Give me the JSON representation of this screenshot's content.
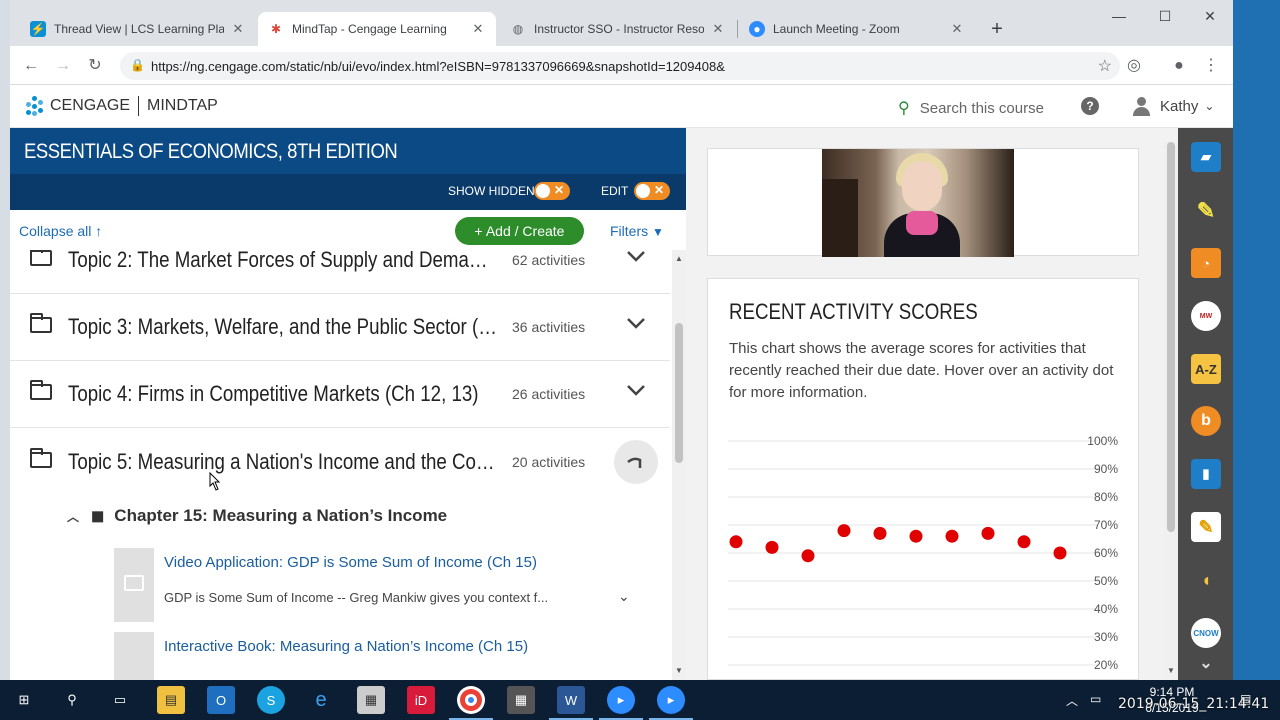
{
  "browser": {
    "tabs": [
      {
        "title": "Thread View | LCS Learning Platf",
        "active": false
      },
      {
        "title": "MindTap - Cengage Learning",
        "active": true
      },
      {
        "title": "Instructor SSO - Instructor Reso",
        "active": false
      },
      {
        "title": "Launch Meeting - Zoom",
        "active": false
      }
    ],
    "url": "https://ng.cengage.com/static/nb/ui/evo/index.html?eISBN=9781337096669&snapshotId=1209408&"
  },
  "header": {
    "brand": "CENGAGE",
    "product": "MINDTAP",
    "search_placeholder": "Search this course",
    "user_name": "Kathy"
  },
  "course": {
    "title": "ESSENTIALS OF ECONOMICS, 8TH EDITION",
    "show_hidden_label": "SHOW HIDDEN",
    "edit_label": "EDIT",
    "collapse_all": "Collapse all",
    "add_create": "Add / Create",
    "filters": "Filters"
  },
  "topics": [
    {
      "title": "Topic 2: The Market Forces of Supply and Demand …",
      "count": "62 activities"
    },
    {
      "title": "Topic 3: Markets, Welfare, and the Public Sector (C…",
      "count": "36 activities"
    },
    {
      "title": "Topic 4: Firms in Competitive Markets (Ch 12, 13)",
      "count": "26 activities"
    },
    {
      "title": "Topic 5: Measuring a Nation's Income and the Cost…",
      "count": "20 activities"
    }
  ],
  "chapter": {
    "title": "Chapter 15: Measuring a Nation’s Income"
  },
  "activities": [
    {
      "title": "Video Application: GDP is Some Sum of Income (Ch 15)",
      "desc": "GDP is Some Sum of Income -- Greg Mankiw gives you context f..."
    },
    {
      "title": "Interactive Book: Measuring a Nation’s Income (Ch 15)",
      "desc": ""
    }
  ],
  "scores": {
    "title": "RECENT ACTIVITY SCORES",
    "description": "This chart shows the average scores for activities that recently reached their due date. Hover over an activity dot for more information."
  },
  "chart_data": {
    "type": "scatter",
    "title": "",
    "y_ticks": [
      "100%",
      "90%",
      "80%",
      "70%",
      "60%",
      "50%",
      "40%",
      "30%",
      "20%"
    ],
    "ylim": [
      20,
      100
    ],
    "values": [
      64,
      62,
      59,
      68,
      67,
      66,
      66,
      67,
      64,
      60
    ],
    "color": "#e00000"
  },
  "taskbar": {
    "time": "9:14 PM",
    "date": "6/15/2019"
  },
  "overlay": {
    "timestamp": "2019-06-15_21:14:41"
  }
}
